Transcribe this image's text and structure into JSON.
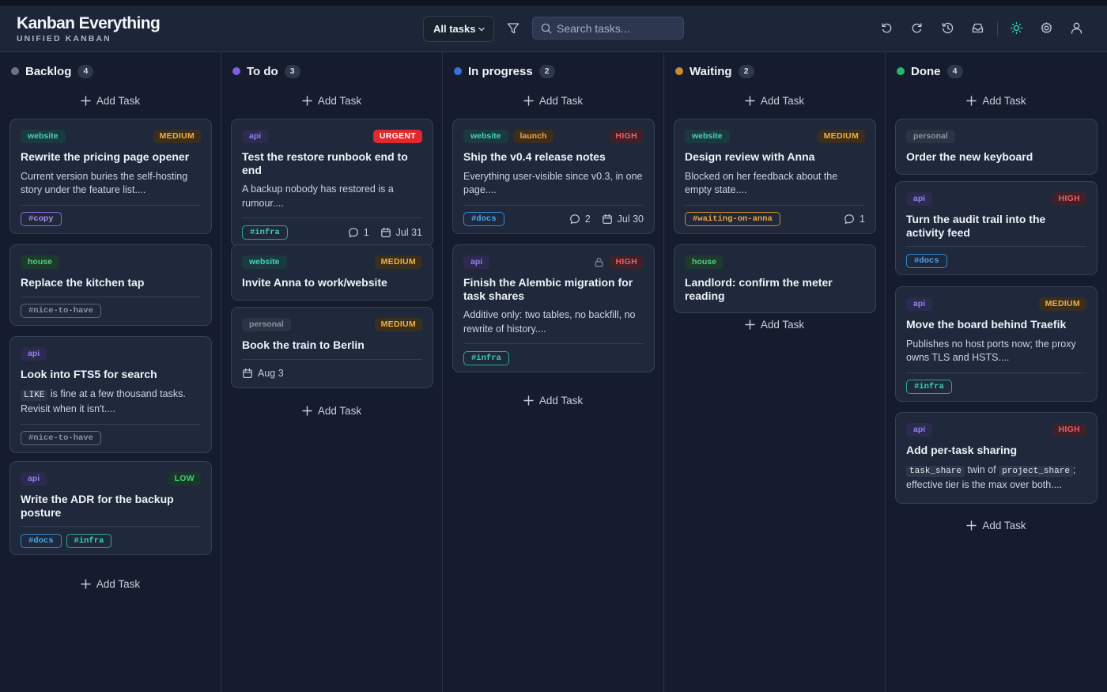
{
  "app": {
    "title": "Kanban Everything",
    "subtitle": "UNIFIED KANBAN"
  },
  "toolbar": {
    "filter_select": "All tasks",
    "search_placeholder": "Search tasks...",
    "icons": [
      "undo-icon",
      "redo-icon",
      "history-icon",
      "inbox-icon",
      "sun-icon",
      "gear-icon",
      "user-icon"
    ]
  },
  "add_task_label": "Add Task",
  "columns": [
    {
      "name": "Backlog",
      "count": "4",
      "dot": "#6b7485",
      "cards": [
        {
          "project": "website",
          "priority": "MEDIUM",
          "title": "Rewrite the pricing page opener",
          "desc": "Current version buries the self-hosting story under the feature list....",
          "labels": [
            "#copy"
          ]
        },
        {
          "project": "house",
          "title": "Replace the kitchen tap",
          "labels": [
            "#nice-to-have"
          ]
        },
        {
          "project": "api",
          "title": "Look into FTS5 for search",
          "desc_code": "LIKE",
          "desc": "is fine at a few thousand tasks. Revisit when it isn't....",
          "labels": [
            "#nice-to-have"
          ]
        },
        {
          "project": "api",
          "priority": "LOW",
          "title": "Write the ADR for the backup posture",
          "labels": [
            "#docs",
            "#infra"
          ]
        }
      ]
    },
    {
      "name": "To do",
      "count": "3",
      "dot": "#7b5fe6",
      "cards": [
        {
          "project": "api",
          "priority": "URGENT",
          "title": "Test the restore runbook end to end",
          "desc": "A backup nobody has restored is a rumour....",
          "labels": [
            "#infra"
          ],
          "comments": "1",
          "due": "Jul 31"
        },
        {
          "project": "website",
          "priority": "MEDIUM",
          "title": "Invite Anna to work/website"
        },
        {
          "project": "personal",
          "priority": "MEDIUM",
          "title": "Book the train to Berlin",
          "due": "Aug 3"
        }
      ]
    },
    {
      "name": "In progress",
      "count": "2",
      "dot": "#3a6fd6",
      "cards": [
        {
          "project": "website",
          "project2": "launch",
          "priority": "HIGH",
          "title": "Ship the v0.4 release notes",
          "desc": "Everything user-visible since v0.3, in one page....",
          "labels": [
            "#docs"
          ],
          "comments": "2",
          "due": "Jul 30"
        },
        {
          "project": "api",
          "priority": "HIGH",
          "title": "Finish the Alembic migration for task shares",
          "desc": "Additive only: two tables, no backfill, no rewrite of history....",
          "labels": [
            "#infra"
          ]
        }
      ]
    },
    {
      "name": "Waiting",
      "count": "2",
      "dot": "#c98b33",
      "cards": [
        {
          "project": "website",
          "priority": "MEDIUM",
          "title": "Design review with Anna",
          "desc": "Blocked on her feedback about the empty state....",
          "labels": [
            "#waiting-on-anna"
          ],
          "comments": "1"
        },
        {
          "project": "house",
          "title": "Landlord: confirm the meter reading"
        }
      ]
    },
    {
      "name": "Done",
      "count": "4",
      "dot": "#2bb56a",
      "cards": [
        {
          "project": "personal",
          "title": "Order the new keyboard"
        },
        {
          "project": "api",
          "priority": "HIGH",
          "title": "Turn the audit trail into the activity feed",
          "labels": [
            "#docs"
          ]
        },
        {
          "project": "api",
          "priority": "MEDIUM",
          "title": "Move the board behind Traefik",
          "desc": "Publishes no host ports now; the proxy owns TLS and HSTS....",
          "labels": [
            "#infra"
          ]
        },
        {
          "project": "api",
          "priority": "HIGH",
          "title": "Add per-task sharing",
          "desc_code": "task_share",
          "desc_mid": "twin of",
          "desc_code2": "project_share",
          "desc_end": ";",
          "desc": "effective tier is the max over both...."
        }
      ]
    }
  ]
}
